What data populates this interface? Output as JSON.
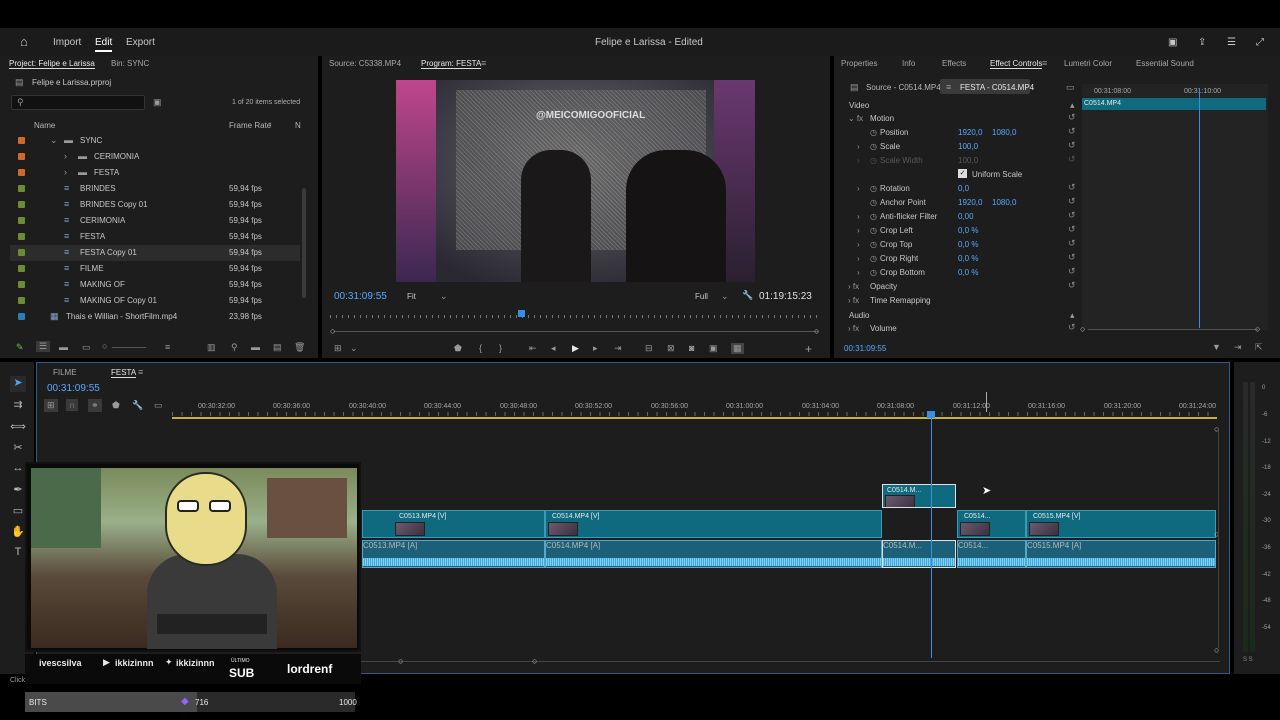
{
  "app": {
    "title": "Felipe e Larissa - Edited",
    "menu": {
      "home": "⌂",
      "import": "Import",
      "edit": "Edit",
      "export": "Export"
    }
  },
  "project": {
    "tab": "Project: Felipe e Larissa",
    "bin_tab": "Bin: SYNC",
    "file": "Felipe e Larissa.prproj",
    "selection": "1 of 20 items selected",
    "col_name": "Name",
    "col_rate": "Frame Rate",
    "col_n": "N",
    "items": [
      {
        "name": "SYNC",
        "rate": "",
        "color": "#d06a2a"
      },
      {
        "name": "CERIMONIA",
        "rate": "",
        "color": "#d06a2a"
      },
      {
        "name": "FESTA",
        "rate": "",
        "color": "#d06a2a"
      },
      {
        "name": "BRINDES",
        "rate": "59,94 fps",
        "color": "#6c8a2e"
      },
      {
        "name": "BRINDES Copy 01",
        "rate": "59,94 fps",
        "color": "#6c8a2e"
      },
      {
        "name": "CERIMONIA",
        "rate": "59,94 fps",
        "color": "#6c8a2e"
      },
      {
        "name": "FESTA",
        "rate": "59,94 fps",
        "color": "#6c8a2e"
      },
      {
        "name": "FESTA Copy 01",
        "rate": "59,94 fps",
        "color": "#6c8a2e"
      },
      {
        "name": "FILME",
        "rate": "59,94 fps",
        "color": "#6c8a2e"
      },
      {
        "name": "MAKING OF",
        "rate": "59,94 fps",
        "color": "#6c8a2e"
      },
      {
        "name": "MAKING OF Copy 01",
        "rate": "59,94 fps",
        "color": "#6c8a2e"
      },
      {
        "name": "Thais e Willian - ShortFilm.mp4",
        "rate": "23,98 fps",
        "color": "#2a7db8"
      }
    ]
  },
  "monitor": {
    "source_tab": "Source: C5338.MP4",
    "program_tab": "Program: FESTA",
    "timecode": "00:31:09:55",
    "fit": "Fit",
    "full": "Full",
    "duration": "01:19:15:23",
    "watermark": "@MEICOMIGOOFICIAL"
  },
  "effects": {
    "tabs": [
      "Properties",
      "Info",
      "Effects",
      "Effect Controls",
      "Lumetri Color",
      "Essential Sound"
    ],
    "source_tab": "Source - C0514.MP4",
    "seq_tab": "FESTA - C0514.MP4",
    "video": "Video",
    "motion": "Motion",
    "position": {
      "label": "Position",
      "x": "1920,0",
      "y": "1080,0"
    },
    "scale": {
      "label": "Scale",
      "v": "100,0"
    },
    "scale_width": {
      "label": "Scale Width",
      "v": "100,0"
    },
    "uniform": "Uniform Scale",
    "rotation": {
      "label": "Rotation",
      "v": "0,0"
    },
    "anchor": {
      "label": "Anchor Point",
      "x": "1920,0",
      "y": "1080,0"
    },
    "antiflicker": {
      "label": "Anti-flicker Filter",
      "v": "0,00"
    },
    "crop_left": {
      "label": "Crop Left",
      "v": "0,0 %"
    },
    "crop_top": {
      "label": "Crop Top",
      "v": "0,0 %"
    },
    "crop_right": {
      "label": "Crop Right",
      "v": "0,0 %"
    },
    "crop_bottom": {
      "label": "Crop Bottom",
      "v": "0,0 %"
    },
    "opacity": "Opacity",
    "time_remap": "Time Remapping",
    "audio": "Audio",
    "volume": "Volume",
    "mini_tc1": "00:31:08:00",
    "mini_tc2": "00:31:10:00",
    "mini_clip": "C0514.MP4",
    "timecode": "00:31:09:55"
  },
  "timeline": {
    "tabs": [
      "FILME",
      "FESTA"
    ],
    "timecode": "00:31:09:55",
    "ticks": [
      "00:30:32:00",
      "00:30:36:00",
      "00:30:40:00",
      "00:30:44:00",
      "00:30:48:00",
      "00:30:52:00",
      "00:30:56:00",
      "00:31:00:00",
      "00:31:04:00",
      "00:31:08:00",
      "00:31:12:00",
      "00:31:16:00",
      "00:31:20:00",
      "00:31:24:00"
    ],
    "clips": {
      "v1a": "C0513.MP4 [V]",
      "v1b": "C0514.MP4 [V]",
      "v1c": "C0514...",
      "v1d": "C0515.MP4 [V]",
      "v2": "C0514.M...",
      "a1a": "C0513.MP4 [A]",
      "a1b": "C0514.MP4 [A]",
      "a1c": "C0514.M...",
      "a1d": "C0514...",
      "a1e": "C0515.MP4 [A]"
    }
  },
  "meter": {
    "labels": [
      "0",
      "-6",
      "-12",
      "-18",
      "-24",
      "-30",
      "-36",
      "-42",
      "-48",
      "-54"
    ],
    "bottom": "S S"
  },
  "overlay": {
    "social": "ivescsilva",
    "yt": "ikkizinnn",
    "tw": "ikkizinnn",
    "last": "ÚLTIMO",
    "sub": "SUB",
    "user": "lordrenf",
    "bits_label": "BITS",
    "bits_value": "716",
    "bits_goal": "1000",
    "bits_progress": 0.716
  },
  "status": {
    "left": "Click"
  }
}
